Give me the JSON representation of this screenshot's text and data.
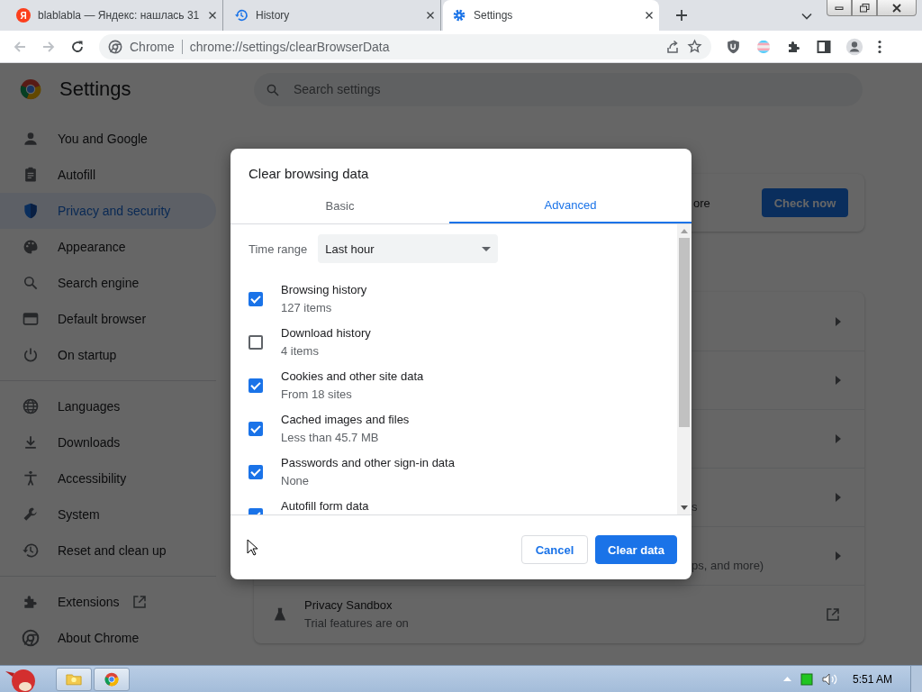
{
  "browser": {
    "tabs": [
      {
        "favicon_letter": "Я",
        "title": "blablabla — Яндекс: нашлась 31",
        "selected": false
      },
      {
        "title": "History",
        "selected": false
      },
      {
        "title": "Settings",
        "selected": true
      }
    ],
    "address": {
      "site_label": "Chrome",
      "url": "chrome://settings/clearBrowserData"
    }
  },
  "settings": {
    "title": "Settings",
    "search_placeholder": "Search settings",
    "nav_groups": [
      {
        "items": [
          {
            "label": "You and Google",
            "selected": false
          },
          {
            "label": "Autofill",
            "selected": false
          },
          {
            "label": "Privacy and security",
            "selected": true
          },
          {
            "label": "Appearance",
            "selected": false
          },
          {
            "label": "Search engine",
            "selected": false
          },
          {
            "label": "Default browser",
            "selected": false
          },
          {
            "label": "On startup",
            "selected": false
          }
        ]
      },
      {
        "items": [
          {
            "label": "Languages",
            "selected": false
          },
          {
            "label": "Downloads",
            "selected": false
          },
          {
            "label": "Accessibility",
            "selected": false
          },
          {
            "label": "System",
            "selected": false
          },
          {
            "label": "Reset and clean up",
            "selected": false
          }
        ]
      },
      {
        "items": [
          {
            "label": "Extensions",
            "selected": false,
            "opens_externally": true
          },
          {
            "label": "About Chrome",
            "selected": false
          }
        ]
      }
    ],
    "safety_check": {
      "visible_text": "ore",
      "button": "Check now"
    },
    "privacy_rows": [
      {
        "kind": "arrow"
      },
      {
        "kind": "arrow"
      },
      {
        "kind": "arrow"
      },
      {
        "kind": "arrow",
        "visible_text": "s"
      },
      {
        "kind": "arrow",
        "visible_text": "ps, and more)"
      },
      {
        "kind": "external",
        "title": "Privacy Sandbox",
        "subtitle": "Trial features are on"
      }
    ]
  },
  "dialog": {
    "title": "Clear browsing data",
    "tabs": [
      {
        "label": "Basic",
        "selected": false
      },
      {
        "label": "Advanced",
        "selected": true
      }
    ],
    "time_range": {
      "label": "Time range",
      "value": "Last hour"
    },
    "options": [
      {
        "label": "Browsing history",
        "detail": "127 items",
        "checked": true
      },
      {
        "label": "Download history",
        "detail": "4 items",
        "checked": false
      },
      {
        "label": "Cookies and other site data",
        "detail": "From 18 sites",
        "checked": true
      },
      {
        "label": "Cached images and files",
        "detail": "Less than 45.7 MB",
        "checked": true
      },
      {
        "label": "Passwords and other sign-in data",
        "detail": "None",
        "checked": true
      },
      {
        "label": "Autofill form data",
        "checked": true
      }
    ],
    "buttons": [
      {
        "label": "Cancel",
        "kind": "secondary"
      },
      {
        "label": "Clear data",
        "kind": "primary"
      }
    ]
  },
  "taskbar": {
    "clock": "5:51 AM"
  }
}
